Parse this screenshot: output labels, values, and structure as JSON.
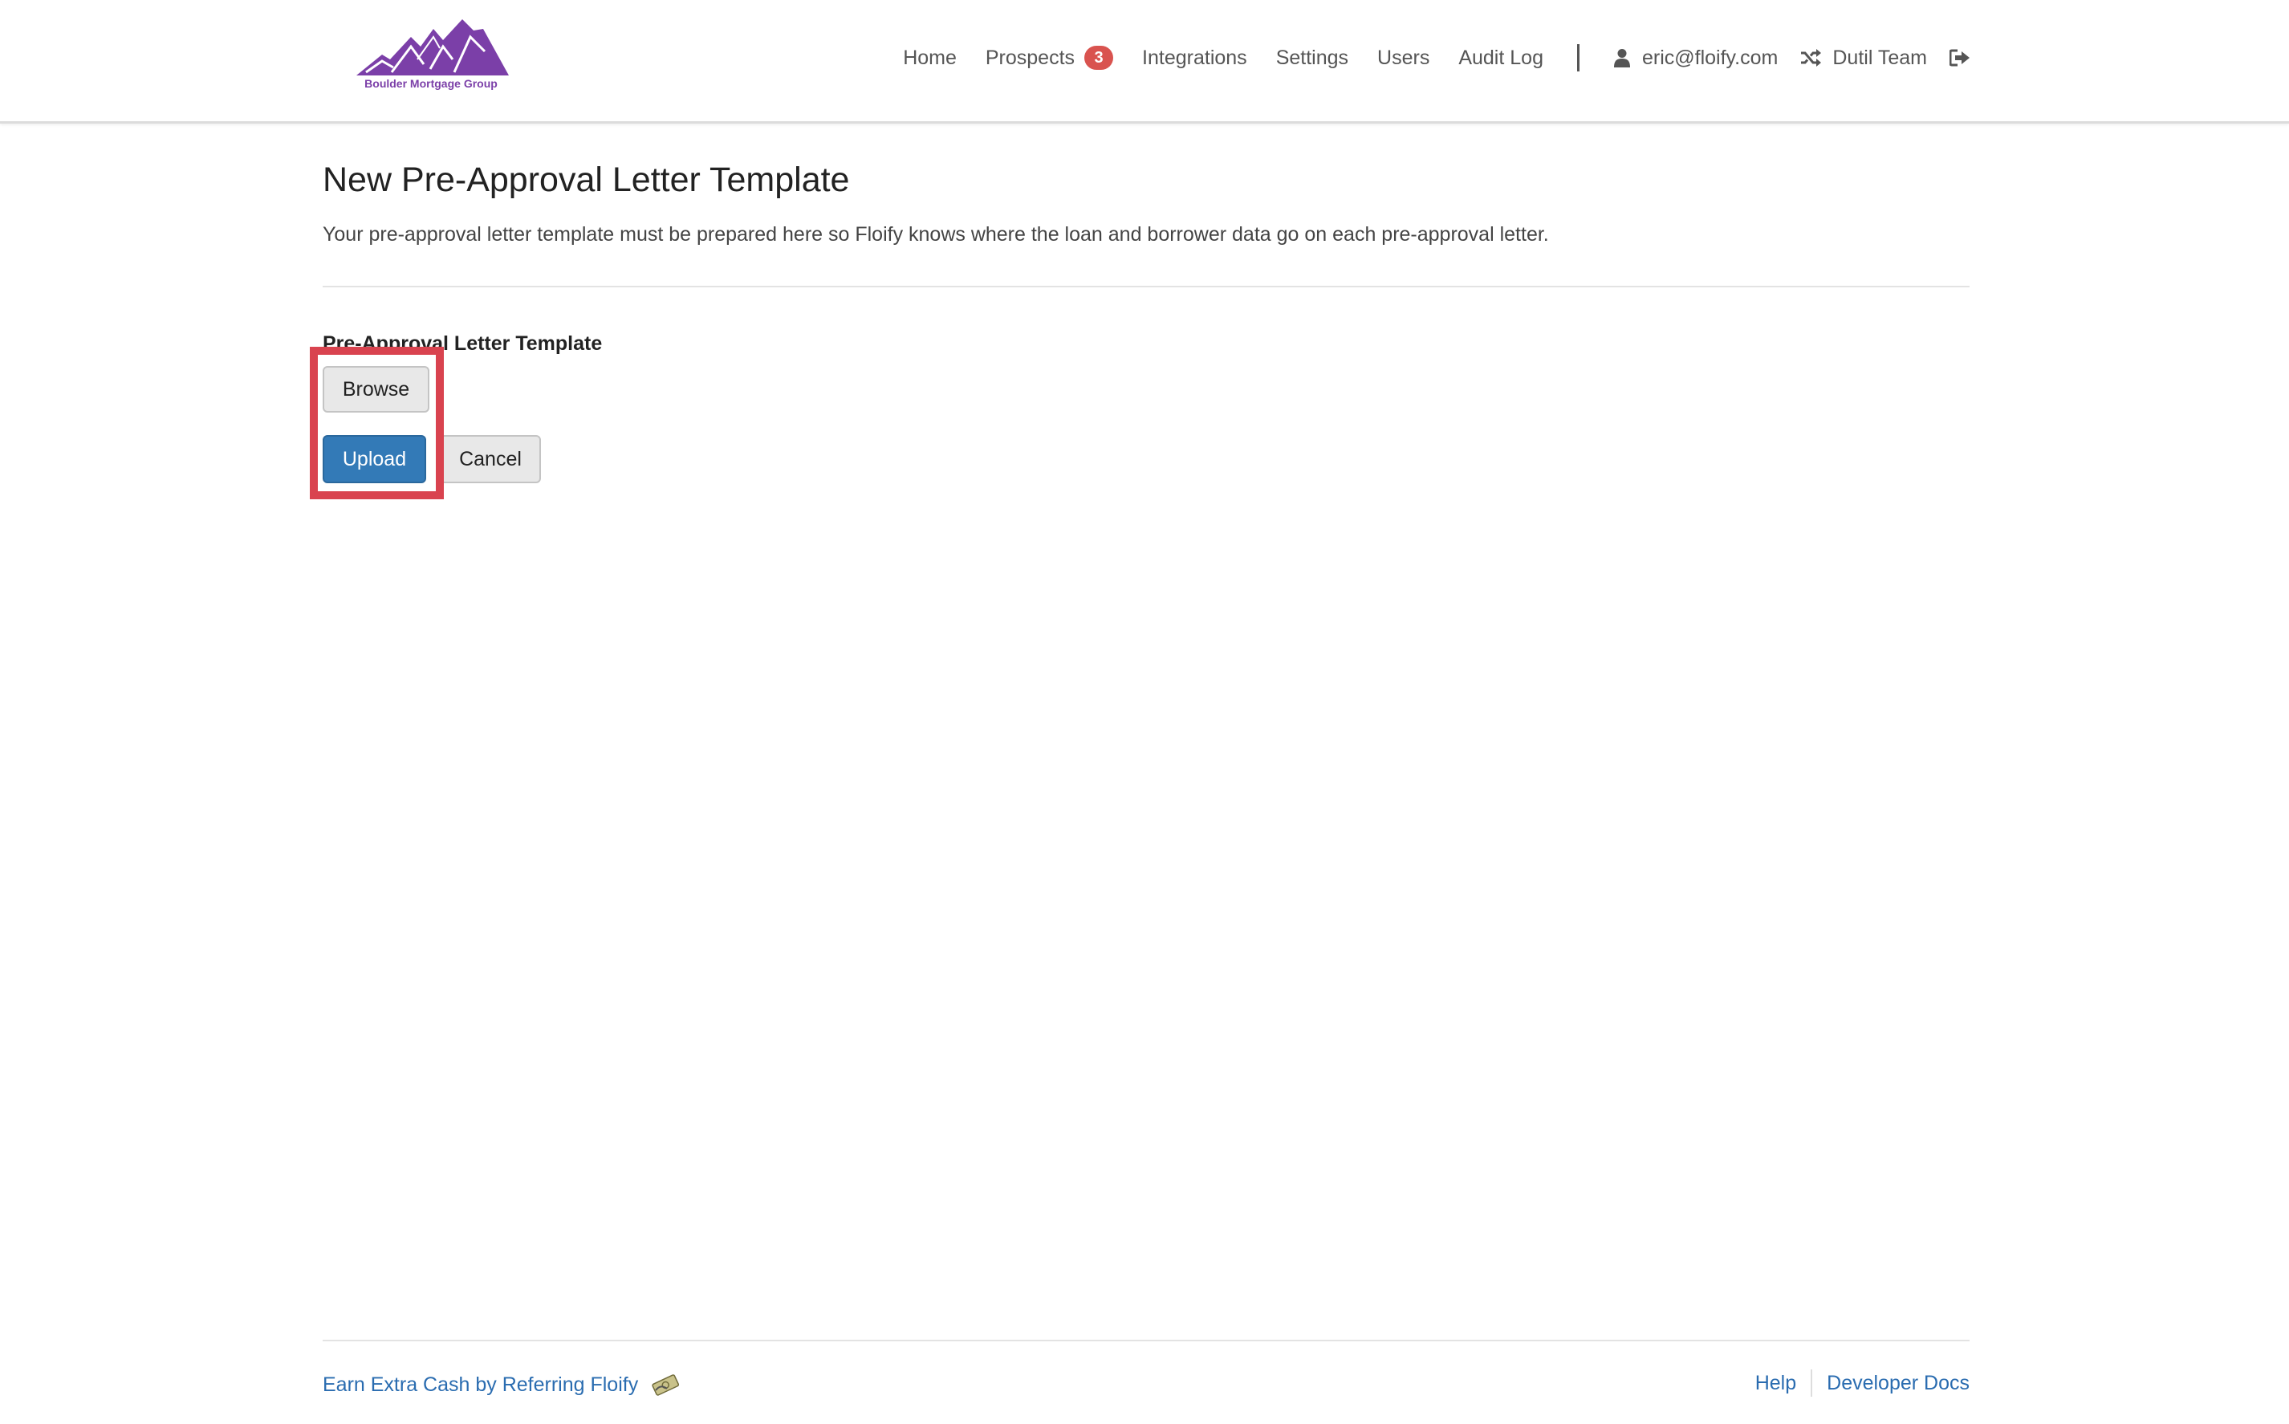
{
  "brand": {
    "name": "Boulder Mortgage Group",
    "logo_color": "#7b3fa8"
  },
  "nav": {
    "items": [
      {
        "label": "Home"
      },
      {
        "label": "Prospects",
        "badge": "3"
      },
      {
        "label": "Integrations"
      },
      {
        "label": "Settings"
      },
      {
        "label": "Users"
      },
      {
        "label": "Audit Log"
      }
    ],
    "user_email": "eric@floify.com",
    "team": "Dutil Team",
    "icons": [
      "user-icon",
      "shuffle-icon",
      "sign-out-icon"
    ]
  },
  "page": {
    "title": "New Pre-Approval Letter Template",
    "description": "Your pre-approval letter template must be prepared here so Floify knows where the loan and borrower data go on each pre-approval letter.",
    "field_label": "Pre-Approval Letter Template",
    "browse_label": "Browse",
    "upload_label": "Upload",
    "cancel_label": "Cancel"
  },
  "footer": {
    "referral_link": "Earn Extra Cash by Referring Floify",
    "help_link": "Help",
    "developer_docs_link": "Developer Docs"
  },
  "colors": {
    "primary": "#337ab7",
    "badge": "#d9534f",
    "highlight": "#d9434f",
    "link": "#2a6cb0"
  }
}
